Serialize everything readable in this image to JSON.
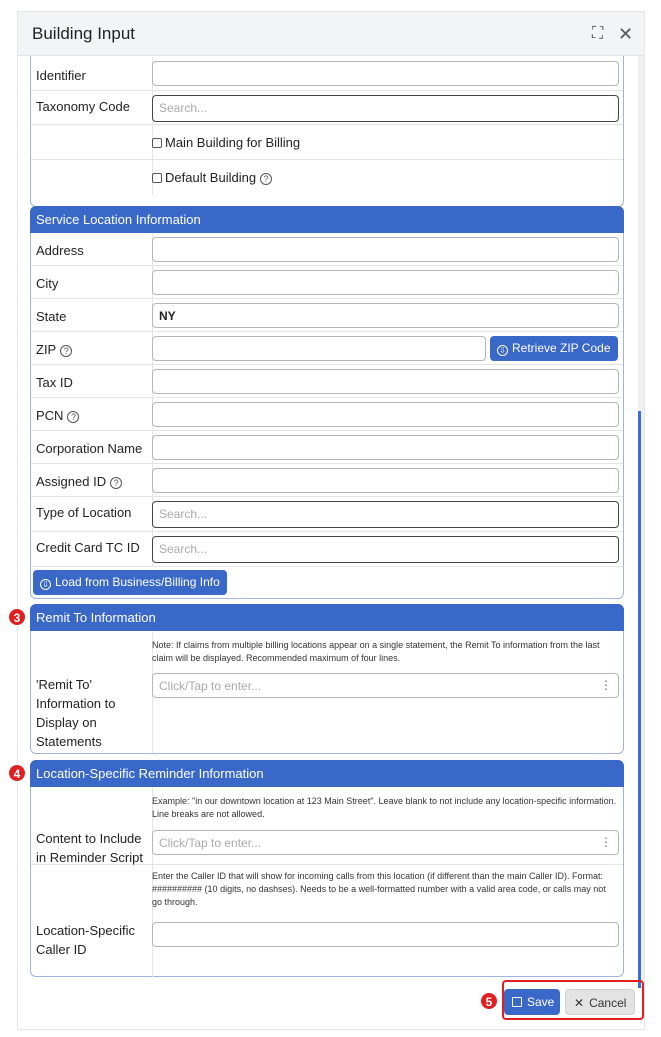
{
  "dialog": {
    "title": "Building Input",
    "expand_icon": "expand-icon",
    "close_icon": "close-icon"
  },
  "building_section": {
    "identifier_label": "Identifier",
    "taxonomy_label": "Taxonomy Code",
    "taxonomy_placeholder": "Search...",
    "main_building_label": "Main Building for Billing",
    "default_building_label": "Default Building"
  },
  "service_location": {
    "header": "Service Location Information",
    "address_label": "Address",
    "city_label": "City",
    "state_label": "State",
    "state_value": "NY",
    "zip_label": "ZIP",
    "retrieve_zip_label": "Retrieve ZIP Code",
    "tax_id_label": "Tax ID",
    "pcn_label": "PCN",
    "corporation_label": "Corporation Name",
    "assigned_id_label": "Assigned ID",
    "type_location_label": "Type of Location",
    "type_location_placeholder": "Search...",
    "credit_card_label": "Credit Card TC ID",
    "credit_card_placeholder": "Search...",
    "load_button_label": "Load from Business/Billing Info"
  },
  "remit_to": {
    "marker": "3",
    "header": "Remit To Information",
    "note": "Note: If claims from multiple billing locations appear on a single statement, the Remit To information from the last claim will be displayed. Recommended maximum of four lines.",
    "label": "'Remit To' Information to Display on Statements",
    "placeholder": "Click/Tap to enter..."
  },
  "reminder": {
    "marker": "4",
    "header": "Location-Specific Reminder Information",
    "example": "Example: \"in our downtown location at 123 Main Street\". Leave blank to not include any location-specific information. Line breaks are not allowed.",
    "content_label": "Content to Include in Reminder Script",
    "content_placeholder": "Click/Tap to enter...",
    "caller_note": "Enter the Caller ID that will show for incoming calls from this location (if different than the main Caller ID). Format: ########## (10 digits, no dashses). Needs to be a well-formatted number with a valid area code, or calls may not go through.",
    "caller_label": "Location-Specific Caller ID"
  },
  "footer": {
    "marker": "5",
    "save_label": "Save",
    "cancel_label": "Cancel"
  },
  "colors": {
    "accent": "#3a68c9",
    "marker": "#e02020"
  }
}
